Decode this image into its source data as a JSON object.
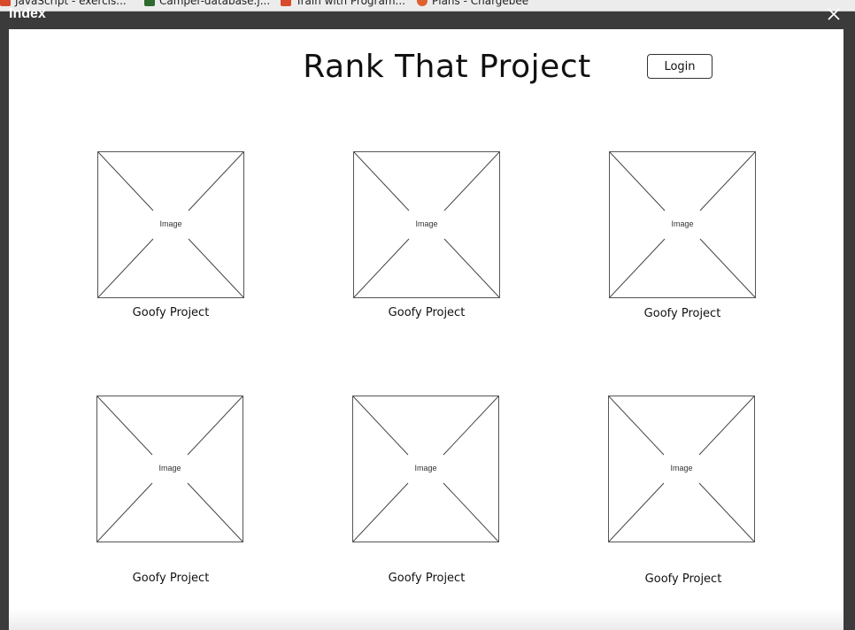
{
  "bookmarks": [
    {
      "label": "JavaScript - exercis...",
      "color": "#d9492b"
    },
    {
      "label": "Camper-database.j...",
      "color": "#2f6b2f"
    },
    {
      "label": "Train with Program...",
      "color": "#d9492b"
    },
    {
      "label": "Plans - Chargebee",
      "color": "#e06030"
    }
  ],
  "window": {
    "title": "Index"
  },
  "header": {
    "title": "Rank That Project",
    "login_label": "Login"
  },
  "projects": [
    {
      "placeholder": "Image",
      "title": "Goofy Project"
    },
    {
      "placeholder": "Image",
      "title": "Goofy Project"
    },
    {
      "placeholder": "Image",
      "title": "Goofy Project"
    },
    {
      "placeholder": "Image",
      "title": "Goofy Project"
    },
    {
      "placeholder": "Image",
      "title": "Goofy Project"
    },
    {
      "placeholder": "Image",
      "title": "Goofy Project"
    }
  ]
}
